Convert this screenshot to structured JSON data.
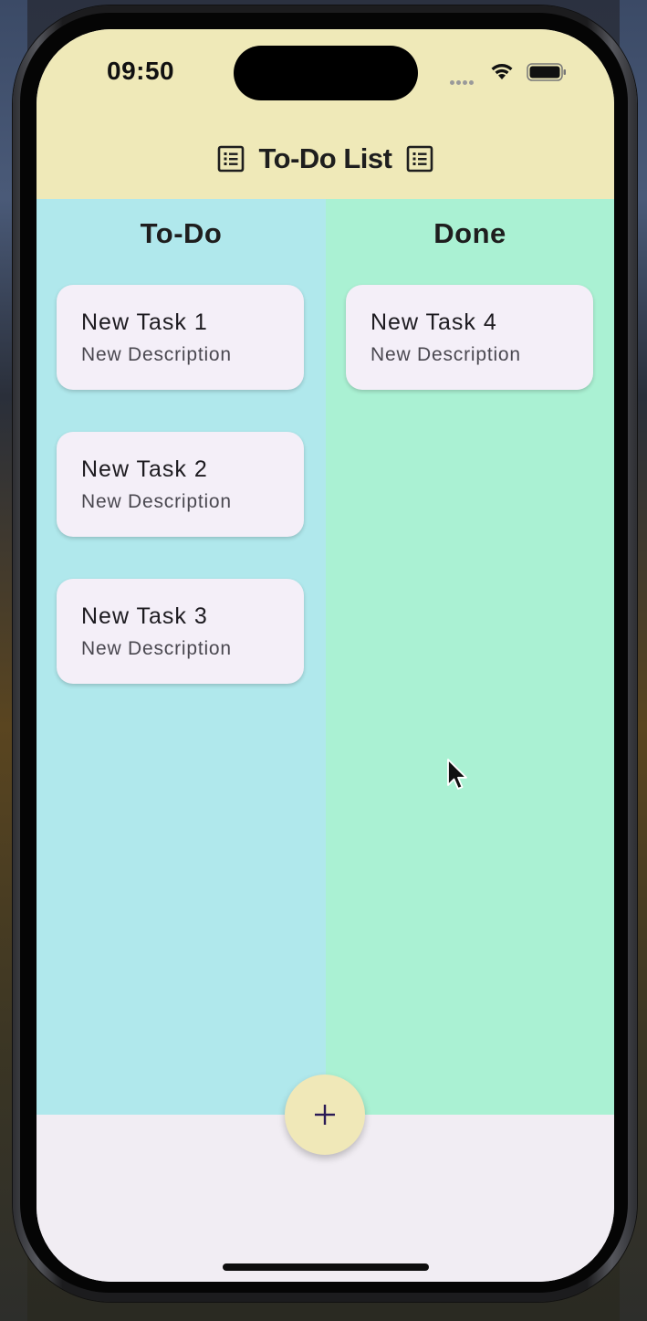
{
  "status_bar": {
    "time": "09:50",
    "signal_icon": "cellular-dots-icon",
    "wifi_icon": "wifi-icon",
    "battery_icon": "battery-full-icon"
  },
  "app_bar": {
    "title": "To-Do List",
    "leading_icon": "list-icon",
    "trailing_icon": "list-icon",
    "color": "#efe9b8"
  },
  "columns": [
    {
      "header": "To-Do",
      "color": "#b0e8ec",
      "cards": [
        {
          "title": "New Task 1",
          "description": "New Description"
        },
        {
          "title": "New Task 2",
          "description": "New Description"
        },
        {
          "title": "New Task 3",
          "description": "New Description"
        }
      ]
    },
    {
      "header": "Done",
      "color": "#aaf1d3",
      "cards": [
        {
          "title": "New Task 4",
          "description": "New Description"
        }
      ]
    }
  ],
  "fab": {
    "label": "+",
    "icon": "plus-icon",
    "color": "#f0e8b8"
  },
  "bottom_bar": {
    "color": "#f1edf3"
  }
}
